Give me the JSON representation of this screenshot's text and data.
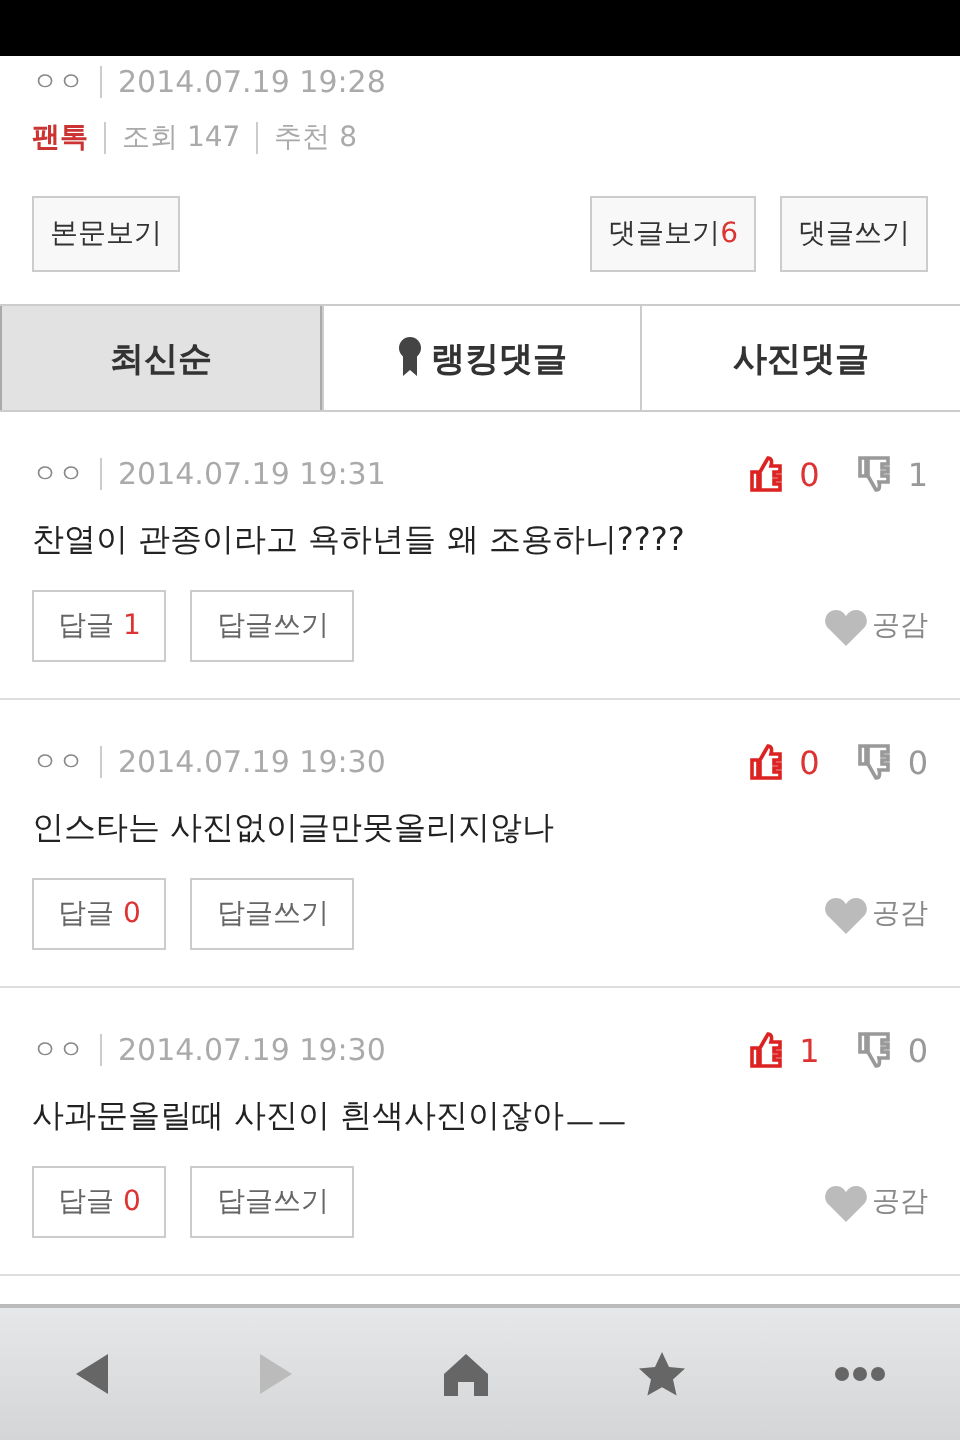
{
  "post": {
    "author": "ㅇㅇ",
    "date": "2014.07.19 19:28",
    "category": "팬톡",
    "views": "조회 147",
    "recommends": "추천 8"
  },
  "actions": [
    {
      "label": "본문보기"
    },
    {
      "label": "댓글보기",
      "count": "6"
    },
    {
      "label": "댓글쓰기"
    }
  ],
  "tabs": [
    {
      "label": "최신순",
      "selected": true,
      "icon": false
    },
    {
      "label": "랭킹댓글",
      "selected": false,
      "icon": true
    },
    {
      "label": "사진댓글",
      "selected": false,
      "icon": false
    }
  ],
  "comments": [
    {
      "author": "ㅇㅇ",
      "date": "2014.07.19 19:31",
      "likes": "0",
      "dislikes": "1",
      "text": "찬열이 관종이라고 욕하년들 왜 조용하니????",
      "reply_label": "답글",
      "reply_count": "1",
      "write_label": "답글쓰기",
      "empathy": "공감"
    },
    {
      "author": "ㅇㅇ",
      "date": "2014.07.19 19:30",
      "likes": "0",
      "dislikes": "0",
      "text": "인스타는 사진없이글만못올리지않나",
      "reply_label": "답글",
      "reply_count": "0",
      "write_label": "답글쓰기",
      "empathy": "공감"
    },
    {
      "author": "ㅇㅇ",
      "date": "2014.07.19 19:30",
      "likes": "1",
      "dislikes": "0",
      "text": "사과문올릴때 사진이 흰색사진이잖아ㅡㅡ",
      "reply_label": "답글",
      "reply_count": "0",
      "write_label": "답글쓰기",
      "empathy": "공감"
    }
  ],
  "toolbar": [
    {
      "kind": "back",
      "disabled": false
    },
    {
      "kind": "forward",
      "disabled": true
    },
    {
      "kind": "home",
      "disabled": false
    },
    {
      "kind": "star",
      "disabled": false
    },
    {
      "kind": "more",
      "disabled": false
    }
  ]
}
